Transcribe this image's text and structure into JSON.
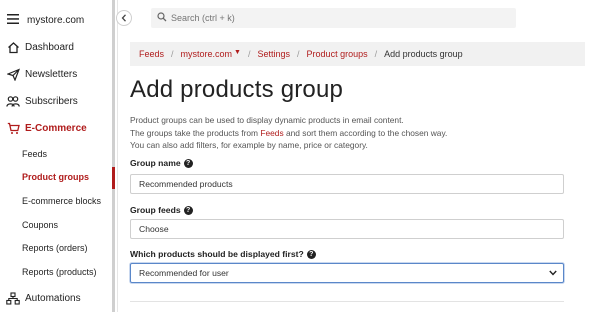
{
  "app": {
    "store_name": "mystore.com"
  },
  "search": {
    "placeholder": "Search (ctrl + k)"
  },
  "sidebar": {
    "items": [
      {
        "label": "Dashboard",
        "icon": "home-icon"
      },
      {
        "label": "Newsletters",
        "icon": "send-icon"
      },
      {
        "label": "Subscribers",
        "icon": "users-icon"
      },
      {
        "label": "E-Commerce",
        "icon": "cart-icon",
        "active": true
      },
      {
        "label": "Automations",
        "icon": "automation-icon"
      }
    ],
    "ecommerce_sub": [
      {
        "label": "Feeds"
      },
      {
        "label": "Product groups",
        "active": true
      },
      {
        "label": "E-commerce blocks"
      },
      {
        "label": "Coupons"
      },
      {
        "label": "Reports (orders)"
      },
      {
        "label": "Reports (products)"
      }
    ]
  },
  "breadcrumb": {
    "items": [
      "Feeds",
      "mystore.com",
      "Settings",
      "Product groups"
    ],
    "current": "Add products group"
  },
  "page": {
    "title": "Add products group",
    "description": {
      "line1": "Product groups can be used to display dynamic products in email content.",
      "line2_prefix": "The groups take the products from ",
      "line2_link": "Feeds",
      "line2_suffix": " and sort them according to the chosen way.",
      "line3": "You can also add filters, for example by name, price or category."
    }
  },
  "form": {
    "group_name_label": "Group name",
    "group_name_value": "Recommended products",
    "group_feeds_label": "Group feeds",
    "group_feeds_value": "Choose",
    "order_label": "Which products should be displayed first?",
    "order_value": "Recommended for user"
  },
  "colors": {
    "accent": "#b01c1c",
    "breadcrumb_bg": "#f1f1f1",
    "focus_border": "#5a87c9"
  }
}
